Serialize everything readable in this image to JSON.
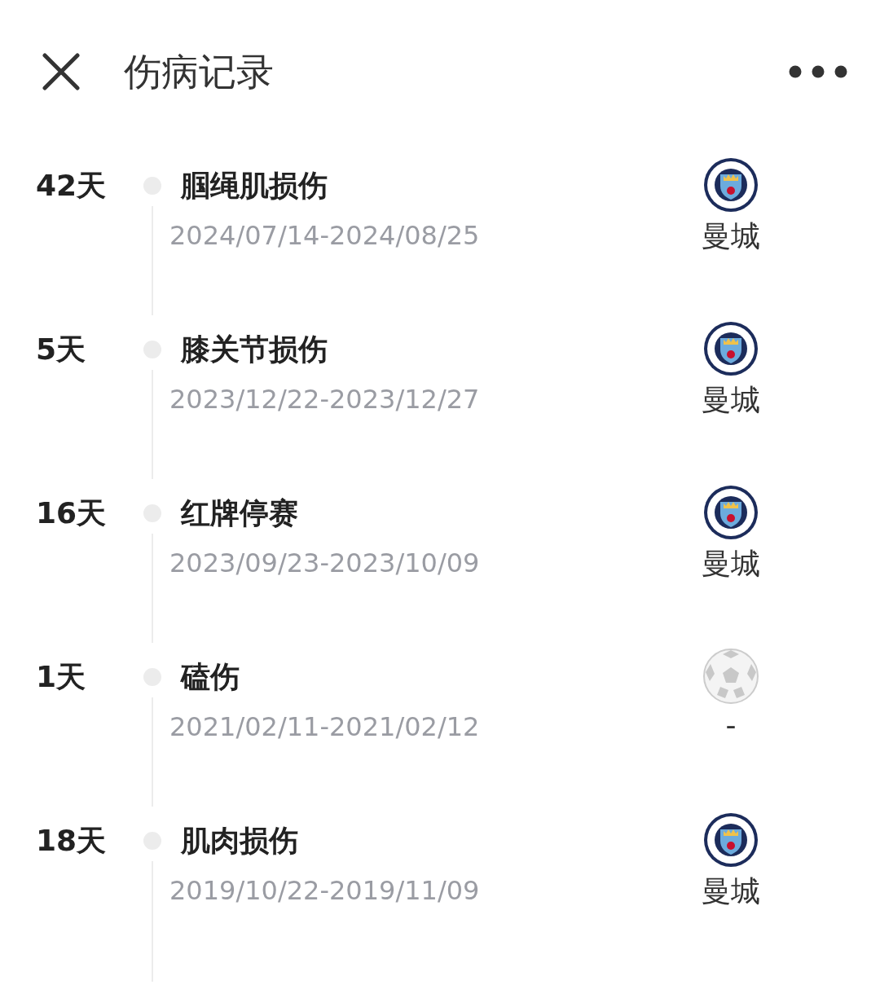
{
  "header": {
    "title": "伤病记录"
  },
  "records": [
    {
      "duration": "42天",
      "injury": "腘绳肌损伤",
      "dates": "2024/07/14-2024/08/25",
      "team": "曼城",
      "kind": "crest"
    },
    {
      "duration": "5天",
      "injury": "膝关节损伤",
      "dates": "2023/12/22-2023/12/27",
      "team": "曼城",
      "kind": "crest"
    },
    {
      "duration": "16天",
      "injury": "红牌停赛",
      "dates": "2023/09/23-2023/10/09",
      "team": "曼城",
      "kind": "crest"
    },
    {
      "duration": "1天",
      "injury": "磕伤",
      "dates": "2021/02/11-2021/02/12",
      "team": "-",
      "kind": "ball"
    },
    {
      "duration": "18天",
      "injury": "肌肉损伤",
      "dates": "2019/10/22-2019/11/09",
      "team": "曼城",
      "kind": "crest"
    }
  ]
}
